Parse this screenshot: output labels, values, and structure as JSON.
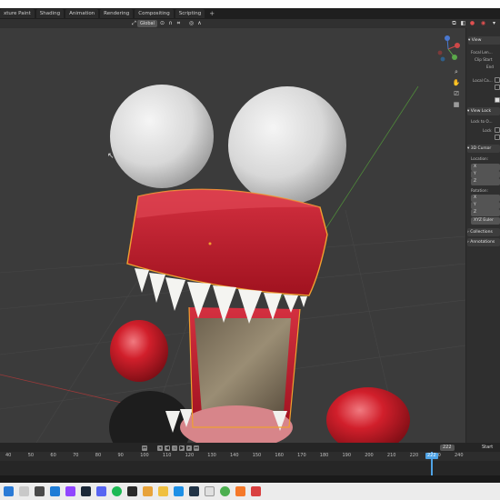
{
  "workspace_tabs": [
    "xture Paint",
    "Shading",
    "Animation",
    "Rendering",
    "Compositing",
    "Scripting"
  ],
  "add_tab": "+",
  "viewport_header": {
    "transform_orientation": "Global",
    "snap_icon": "magnet-icon",
    "proportional_icon": "proportional-edit-icon"
  },
  "npanel": {
    "view_header": "View",
    "focal_length": "Focal Len...",
    "clip_start": "Clip Start",
    "clip_end": "End",
    "local_camera": "Local Ca...",
    "view_lock_header": "View Lock",
    "lock_to": "Lock to O...",
    "lock": "Lock",
    "cursor_header": "3D Cursor",
    "location": "Location:",
    "rotation": "Rotation:",
    "x": "X",
    "y": "Y",
    "z": "Z",
    "rotation_mode": "XYZ Euler",
    "collections_header": "Collections",
    "annotations_header": "Annotations"
  },
  "timeline": {
    "ticks": [
      "40",
      "50",
      "60",
      "70",
      "80",
      "90",
      "100",
      "110",
      "120",
      "130",
      "140",
      "150",
      "160",
      "170",
      "180",
      "190",
      "200",
      "210",
      "220",
      "230",
      "240"
    ],
    "current_frame": "222",
    "current_frame_field": "222",
    "start_label": "Start"
  },
  "colors": {
    "accent": "#4fa3e5",
    "mouth_red": "#c0202f",
    "selection_outline": "#f0a030"
  },
  "taskbar_icons": [
    "start-icon",
    "search-icon",
    "taskview-icon",
    "explorer-icon",
    "twitch-icon",
    "steam-icon",
    "discord-icon",
    "spotify-icon",
    "store-icon",
    "settings-icon",
    "folder-icon",
    "chrome-icon",
    "media-icon",
    "steam2-icon",
    "files-icon",
    "blender-icon"
  ]
}
